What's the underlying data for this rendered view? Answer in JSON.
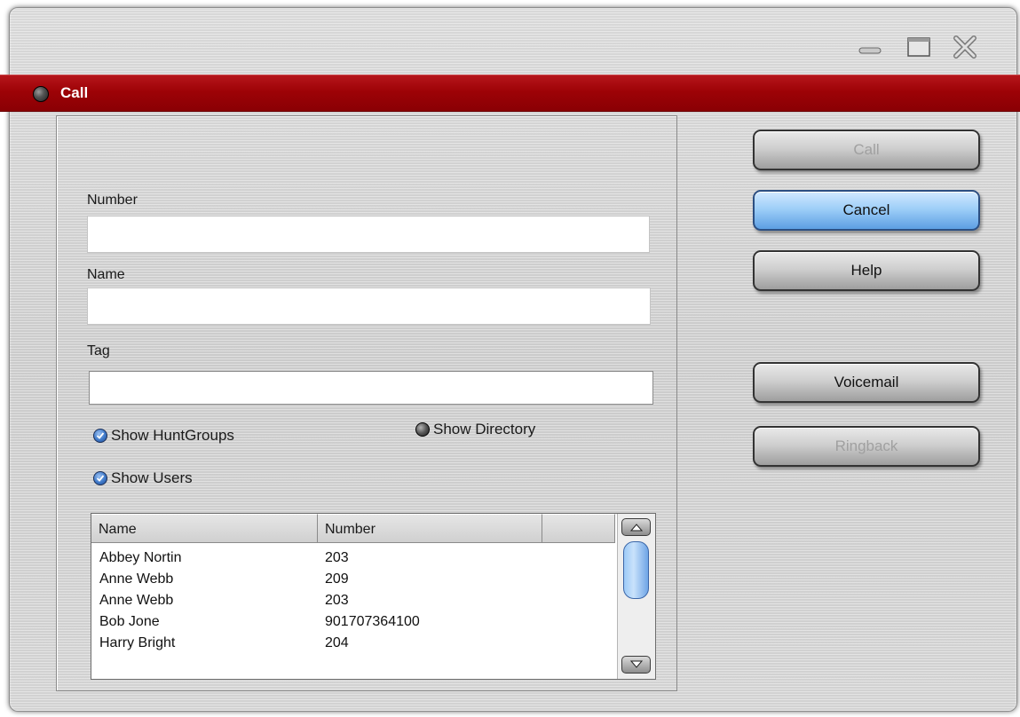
{
  "window": {
    "title": "Call",
    "controls": [
      "minimize-icon",
      "maximize-icon",
      "close-icon"
    ]
  },
  "form": {
    "number": {
      "label": "Number",
      "value": ""
    },
    "name": {
      "label": "Name",
      "value": ""
    },
    "tag": {
      "label": "Tag",
      "value": ""
    },
    "options": {
      "show_huntgroups": {
        "label": "Show HuntGroups",
        "checked": true
      },
      "show_directory": {
        "label": "Show Directory",
        "checked": false
      },
      "show_users": {
        "label": "Show Users",
        "checked": true
      }
    }
  },
  "list": {
    "columns": [
      "Name",
      "Number",
      ""
    ],
    "rows": [
      {
        "name": "Abbey Nortin",
        "number": "203"
      },
      {
        "name": "Anne Webb",
        "number": "209"
      },
      {
        "name": "Anne Webb",
        "number": "203"
      },
      {
        "name": "Bob Jone",
        "number": "901707364100"
      },
      {
        "name": "Harry Bright",
        "number": "204"
      }
    ]
  },
  "buttons": {
    "call": "Call",
    "cancel": "Cancel",
    "help": "Help",
    "voicemail": "Voicemail",
    "ringback": "Ringback"
  },
  "colors": {
    "titlebar": "#9d0206",
    "primary_button": "#9fcff8",
    "radio_checked": "#3f79c9"
  }
}
